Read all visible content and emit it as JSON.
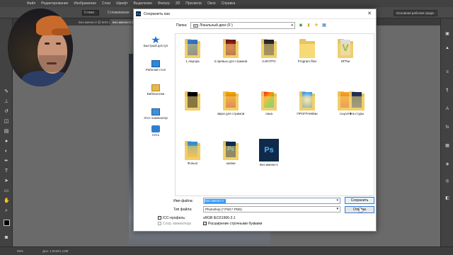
{
  "ps": {
    "menu": [
      "Файл",
      "Редактирование",
      "Изображение",
      "Слои",
      "Шрифт",
      "Выделение",
      "Фильтр",
      "3D",
      "Просмотр",
      "Окно",
      "Справка"
    ],
    "options": {
      "size_value": "0 пикс.",
      "antialias": "Сглаживание",
      "style": "Обычный",
      "workspace": "Основная рабочая среда"
    },
    "tabs": [
      "Без имени-2 @ 50% (RGB/8) *",
      "Без имени-3 @ 66,7% (RGB/8) *"
    ],
    "status": {
      "zoom": "99%",
      "doc": "Док: 1,81М/1,13М"
    }
  },
  "dialog": {
    "title": "Сохранить как",
    "folder_label": "Папка:",
    "folder_value": "Локальный диск (F:)",
    "places": [
      {
        "label": "Быстрый доступ",
        "icon": "star-icon"
      },
      {
        "label": "Рабочий стол",
        "icon": "desktop-icon"
      },
      {
        "label": "Библиотеки",
        "icon": "library-icon"
      },
      {
        "label": "Этот компьютер",
        "icon": "computer-icon"
      },
      {
        "label": "Сеть",
        "icon": "network-icon"
      }
    ],
    "files": [
      {
        "name": "1.Аврора",
        "kind": "folder-blue"
      },
      {
        "name": "2.превью для стримов",
        "kind": "folder-red"
      },
      {
        "name": "3.ИНТРО",
        "kind": "folder-dark"
      },
      {
        "name": "Program files",
        "kind": "folder"
      },
      {
        "name": "ИГРЫ",
        "kind": "folder-green"
      },
      {
        "name": "",
        "kind": "folder-black"
      },
      {
        "name": "звуки для стримов",
        "kind": "folder-orange"
      },
      {
        "name": "лана",
        "kind": "folder-colorful"
      },
      {
        "name": "ПРОГРАММЫ",
        "kind": "folder-blue2"
      },
      {
        "name": "соцсети",
        "kind": "folder-orange2"
      },
      {
        "name": "Тек.стуры",
        "kind": "folder-dark2"
      },
      {
        "name": "Фоны2",
        "kind": "folder-bright"
      },
      {
        "name": "шапки",
        "kind": "ps-folder"
      },
      {
        "name": "Без имени-1",
        "kind": "ps-file"
      }
    ],
    "filename_label": "Имя файла:",
    "filename_value": "Без имени-3",
    "filetype_label": "Тип файла:",
    "filetype_value": "Photoshop (*.PSD;*.PDD)",
    "save_button": "Сохранить",
    "cancel_button": "Отмена",
    "icc_label": "ICC-профиль:",
    "icc_value": "sRGB IEC61966-2.1",
    "thumbnail_label": "Сохр. миниатюру",
    "lowercase_label": "Расширение строчными буквами",
    "checks": {
      "icc": false,
      "thumbnail": true,
      "lowercase": true
    }
  }
}
